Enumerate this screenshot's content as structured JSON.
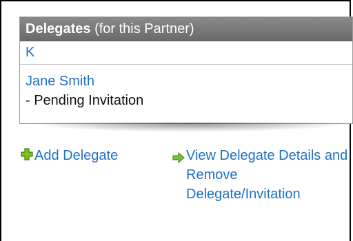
{
  "panel": {
    "title": "Delegates",
    "subtitle": "(for this Partner)",
    "initial": "K",
    "delegate": {
      "name": "Jane Smith",
      "status": "- Pending Invitation"
    }
  },
  "actions": {
    "add_delegate": "Add Delegate",
    "view_delegate": "View Delegate Details and Remove Delegate/Invitation"
  },
  "icons": {
    "add": "plus-icon",
    "view": "arrow-right-icon"
  },
  "colors": {
    "link": "#1f6fc6",
    "header": "#7a7a7a",
    "plus": "#7ec21a",
    "arrow": "#77c23a"
  }
}
